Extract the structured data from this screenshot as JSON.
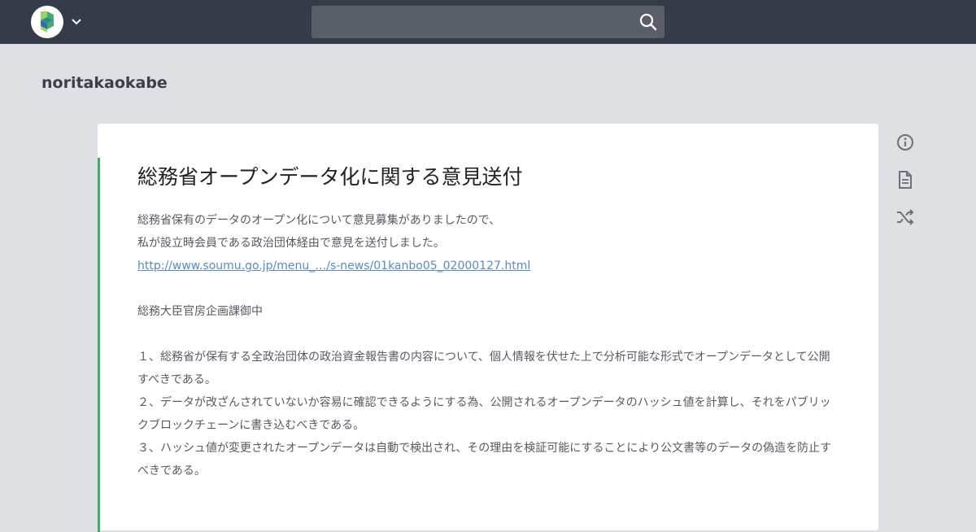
{
  "header": {
    "logo_icon": "app-logo-icon",
    "menu_icon": "chevron-down-icon",
    "search_placeholder": "",
    "search_icon": "search-icon"
  },
  "profile": {
    "username": "noritakaokabe"
  },
  "post": {
    "title": "総務省オープンデータ化に関する意見送付",
    "body": {
      "intro_1": "総務省保有のデータのオープン化について意見募集がありましたので、",
      "intro_2": "私が設立時会員である政治団体経由で意見を送付しました。",
      "link": "http://www.soumu.go.jp/menu_…/s-news/01kanbo05_02000127.html",
      "addressee": "総務大臣官房企画課御中",
      "point_1": "１、総務省が保有する全政治団体の政治資金報告書の内容について、個人情報を伏せた上で分析可能な形式でオープンデータとして公開すべきである。",
      "point_2": "２、データが改ざんされていないか容易に確認できるようにする為、公開されるオープンデータのハッシュ値を計算し、それをパブリックブロックチェーンに書き込むべきである。",
      "point_3": "３、ハッシュ値が変更されたオープンデータは自動で検出され、その理由を検証可能にすることにより公文書等のデータの偽造を防止すべきである。"
    }
  },
  "side_actions": [
    {
      "icon": "info-icon"
    },
    {
      "icon": "document-icon"
    },
    {
      "icon": "shuffle-icon"
    }
  ],
  "colors": {
    "topbar": "#363b49",
    "background": "#dfe0e3",
    "accent": "#3dae6e",
    "link": "#5b8ac4"
  }
}
